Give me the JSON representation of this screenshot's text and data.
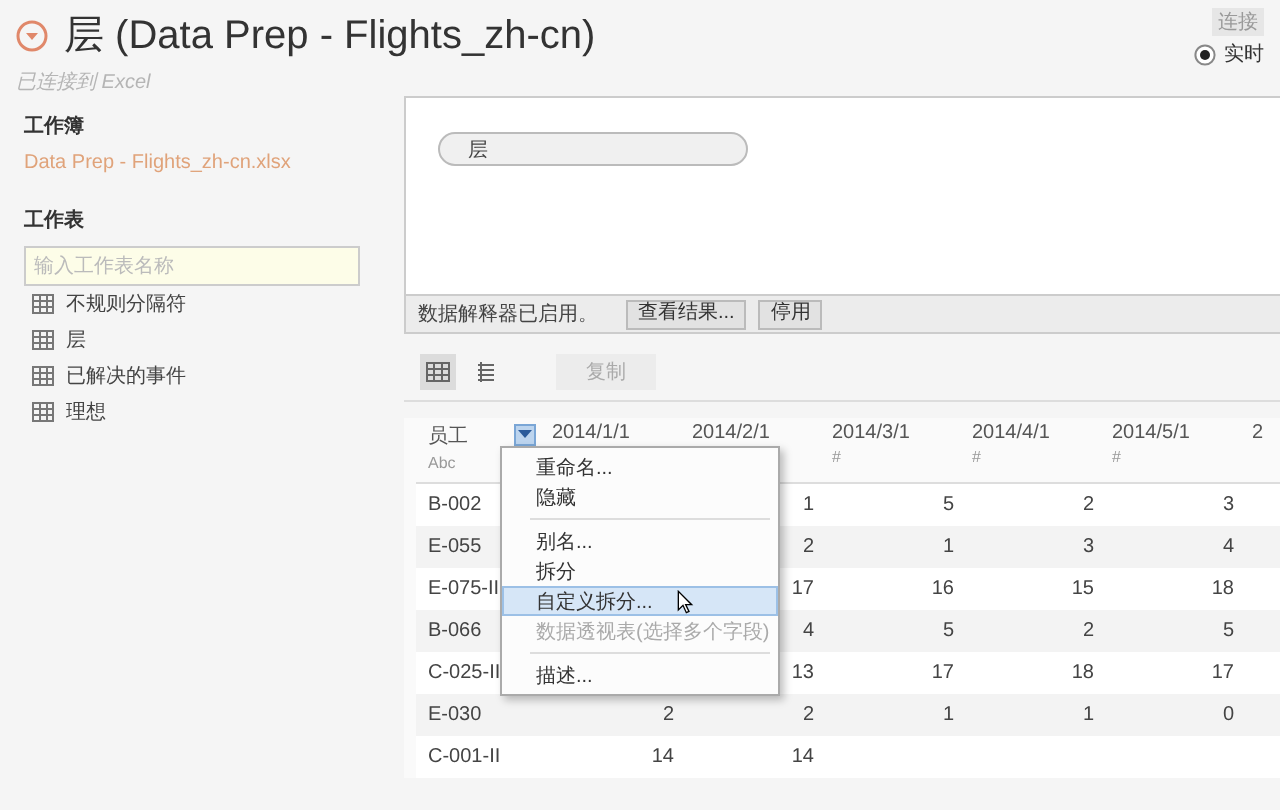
{
  "header": {
    "title": "层 (Data Prep - Flights_zh-cn)",
    "subtitle": "已连接到 Excel"
  },
  "connection": {
    "label": "连接",
    "options": [
      {
        "label": "实时",
        "selected": true
      }
    ]
  },
  "sidebar": {
    "workbook_heading": "工作簿",
    "workbook_file": "Data Prep - Flights_zh-cn.xlsx",
    "sheets_heading": "工作表",
    "search": {
      "placeholder": "输入工作表名称"
    },
    "sheets": [
      {
        "label": "不规则分隔符"
      },
      {
        "label": "层"
      },
      {
        "label": "已解决的事件"
      },
      {
        "label": "理想"
      }
    ]
  },
  "join_area": {
    "tables": [
      {
        "label": "层"
      }
    ]
  },
  "interpreter_bar": {
    "message": "数据解释器已启用。",
    "buttons": [
      {
        "label": "查看结果...",
        "disabled": false
      },
      {
        "label": "停用",
        "disabled": false
      }
    ]
  },
  "toolbar": {
    "views": [
      {
        "kind": "grid",
        "selected": true
      },
      {
        "kind": "list",
        "selected": false
      }
    ],
    "copy_button": {
      "label": "复制",
      "disabled": true
    }
  },
  "table": {
    "columns": [
      {
        "label": "员工",
        "type": "Abc",
        "has_menu": true
      },
      {
        "label": "2014/1/1"
      },
      {
        "label": "2014/2/1"
      },
      {
        "label": "2014/3/1",
        "type": "#"
      },
      {
        "label": "2014/4/1",
        "type": "#"
      },
      {
        "label": "2014/5/1",
        "type": "#"
      },
      {
        "label": "2"
      }
    ],
    "rows": [
      [
        "B-002",
        null,
        "1",
        "5",
        "2",
        "3"
      ],
      [
        "E-055",
        null,
        "2",
        "1",
        "3",
        "4"
      ],
      [
        "E-075-II",
        null,
        "17",
        "16",
        "15",
        "18"
      ],
      [
        "B-066",
        null,
        "4",
        "5",
        "2",
        "5"
      ],
      [
        "C-025-II",
        null,
        "13",
        "17",
        "18",
        "17"
      ],
      [
        "E-030",
        "2",
        "2",
        "1",
        "1",
        "0"
      ],
      [
        "C-001-II",
        "14",
        "14",
        null,
        null,
        null
      ]
    ]
  },
  "column_menu": {
    "items": [
      {
        "kind": "item",
        "label": "重命名...",
        "highlighted": false,
        "disabled": false
      },
      {
        "kind": "item",
        "label": "隐藏",
        "highlighted": false,
        "disabled": false
      },
      {
        "kind": "separator"
      },
      {
        "kind": "item",
        "label": "别名...",
        "highlighted": false,
        "disabled": false
      },
      {
        "kind": "item",
        "label": "拆分",
        "highlighted": false,
        "disabled": false
      },
      {
        "kind": "item",
        "label": "自定义拆分...",
        "highlighted": true,
        "disabled": false
      },
      {
        "kind": "item",
        "label": "数据透视表(选择多个字段)",
        "highlighted": false,
        "disabled": true
      },
      {
        "kind": "separator"
      },
      {
        "kind": "item",
        "label": "描述...",
        "highlighted": false,
        "disabled": false
      }
    ]
  }
}
